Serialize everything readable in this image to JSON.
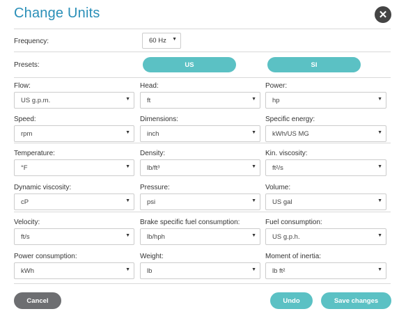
{
  "dialog": {
    "title": "Change Units",
    "close_icon": "close-icon"
  },
  "frequency": {
    "label": "Frequency:",
    "value": "60 Hz"
  },
  "presets": {
    "label": "Presets:",
    "us_label": "US",
    "si_label": "SI"
  },
  "fields": [
    {
      "label": "Flow:",
      "value": "US g.p.m."
    },
    {
      "label": "Head:",
      "value": "ft"
    },
    {
      "label": "Power:",
      "value": "hp"
    },
    {
      "label": "Speed:",
      "value": "rpm"
    },
    {
      "label": "Dimensions:",
      "value": "inch"
    },
    {
      "label": "Specific energy:",
      "value": "kWh/US MG"
    },
    {
      "label": "Temperature:",
      "value": "°F"
    },
    {
      "label": "Density:",
      "value": "lb/ft³"
    },
    {
      "label": "Kin. viscosity:",
      "value": "ft²/s"
    },
    {
      "label": "Dynamic viscosity:",
      "value": "cP"
    },
    {
      "label": "Pressure:",
      "value": "psi"
    },
    {
      "label": "Volume:",
      "value": "US gal"
    },
    {
      "label": "Velocity:",
      "value": "ft/s"
    },
    {
      "label": "Brake specific fuel consumption:",
      "value": "lb/hph"
    },
    {
      "label": "Fuel consumption:",
      "value": "US g.p.h."
    },
    {
      "label": "Power consumption:",
      "value": "kWh"
    },
    {
      "label": "Weight:",
      "value": "lb"
    },
    {
      "label": "Moment of inertia:",
      "value": "lb ft²"
    }
  ],
  "footer": {
    "cancel_label": "Cancel",
    "undo_label": "Undo",
    "save_label": "Save changes"
  },
  "colors": {
    "title": "#2a8fb8",
    "accent": "#5bc1c4",
    "cancel": "#6d6e71"
  }
}
